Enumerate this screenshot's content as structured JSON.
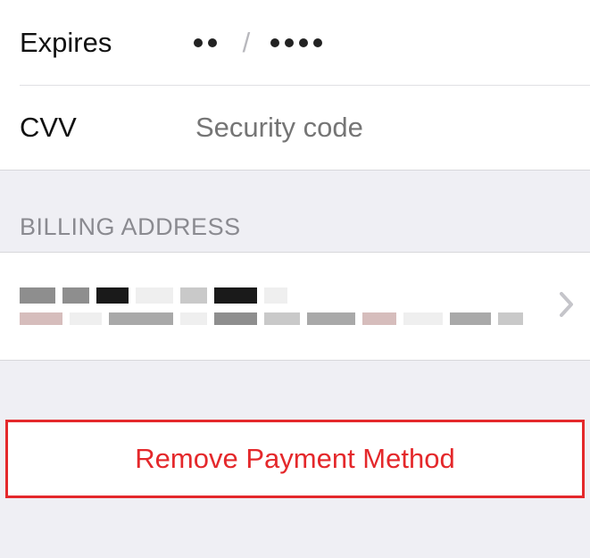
{
  "card": {
    "expires_label": "Expires",
    "cvv_label": "CVV",
    "cvv_placeholder": "Security code"
  },
  "billing": {
    "section_title": "BILLING ADDRESS"
  },
  "remove": {
    "label": "Remove Payment Method"
  },
  "colors": {
    "destructive": "#e4282b",
    "placeholder": "#9a9aa0"
  }
}
